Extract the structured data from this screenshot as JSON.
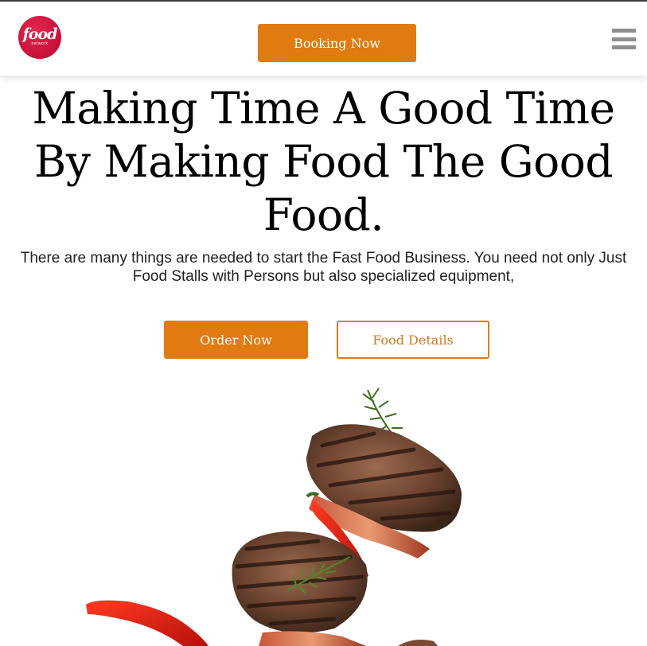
{
  "header": {
    "logo": {
      "word": "food",
      "sub": "network"
    },
    "booking_button": "Booking Now",
    "menu_icon": "hamburger-menu-icon"
  },
  "hero": {
    "title": "Making Time A Good Time By Making Food The Good Food.",
    "description": "There are many things are needed to start the Fast Food Business. You need not only Just Food Stalls with Persons but also specialized equipment,",
    "order_button": "Order Now",
    "details_button": "Food Details",
    "image": "flying-burger-patties-with-bacon-chili-and-rosemary"
  },
  "colors": {
    "accent": "#e07b12",
    "logo_red": "#c8103a",
    "menu_gray": "#8f8f8f",
    "text_dark": "#000000"
  }
}
